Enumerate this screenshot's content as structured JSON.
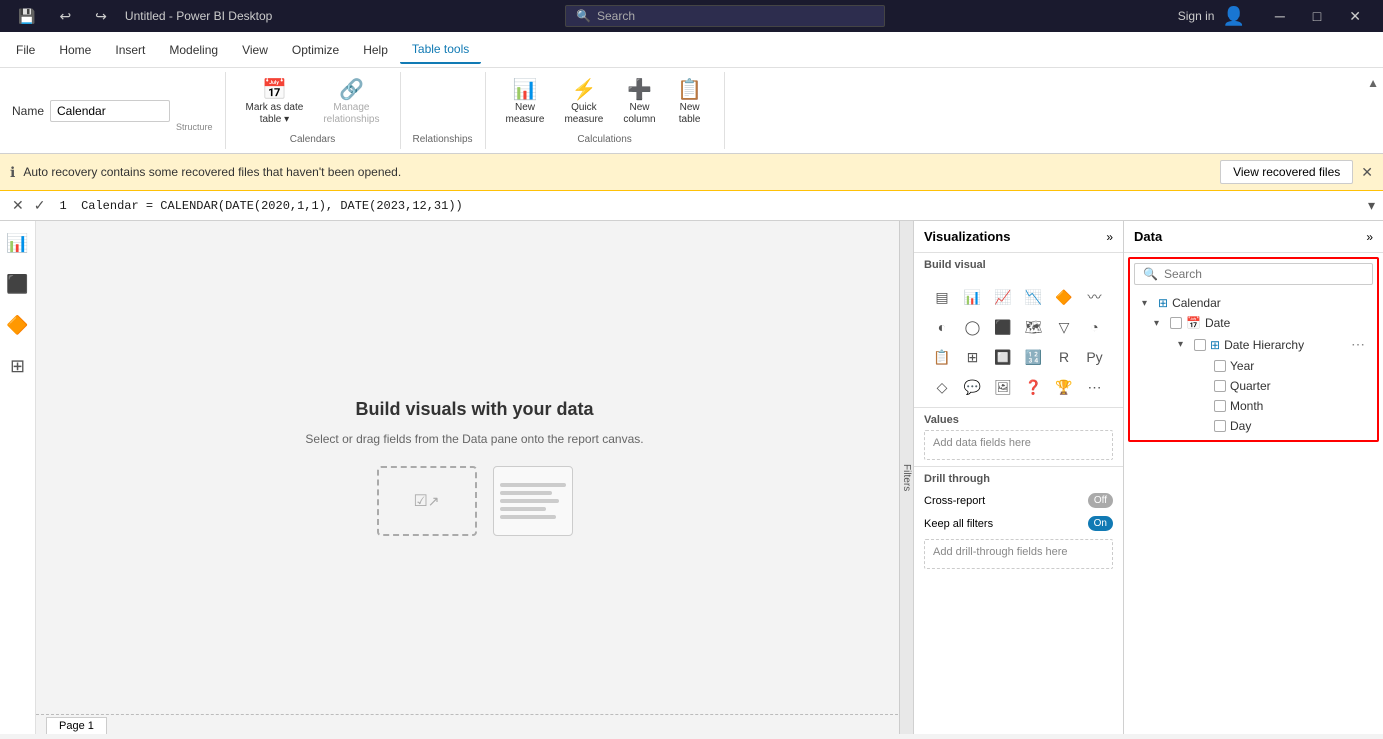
{
  "titleBar": {
    "appName": "Untitled - Power BI Desktop",
    "searchPlaceholder": "Search",
    "signIn": "Sign in"
  },
  "menuBar": {
    "items": [
      "File",
      "Home",
      "Insert",
      "Modeling",
      "View",
      "Optimize",
      "Help",
      "Table tools"
    ]
  },
  "ribbon": {
    "nameLabel": "Name",
    "nameValue": "Calendar",
    "groups": [
      {
        "label": "Structure",
        "buttons": []
      },
      {
        "label": "Calendars",
        "buttons": [
          {
            "icon": "📅",
            "label": "Mark as date\ntable ▾",
            "disabled": false
          },
          {
            "icon": "🔗",
            "label": "Manage\nrelationships",
            "disabled": true
          }
        ]
      },
      {
        "label": "Relationships",
        "buttons": []
      },
      {
        "label": "Calculations",
        "buttons": [
          {
            "icon": "📊",
            "label": "New\nmeasure",
            "disabled": false
          },
          {
            "icon": "⚡",
            "label": "Quick\nmeasure",
            "disabled": false
          },
          {
            "icon": "➕",
            "label": "New\ncolumn",
            "disabled": false
          },
          {
            "icon": "📋",
            "label": "New\ntable",
            "disabled": false
          }
        ]
      }
    ]
  },
  "notification": {
    "message": "Auto recovery contains some recovered files that haven't been opened.",
    "buttonLabel": "View recovered files"
  },
  "formulaBar": {
    "formula": "1  Calendar = CALENDAR(DATE(2020,1,1), DATE(2023,12,31))"
  },
  "canvas": {
    "title": "Build visuals with your data",
    "subtitle": "Select or drag fields from the Data pane onto the report canvas.",
    "pageTab": "Page 1",
    "filtersLabel": "Filters"
  },
  "visualizations": {
    "title": "Visualizations",
    "buildVisualLabel": "Build visual",
    "icons": [
      "▤",
      "📊",
      "📈",
      "📉",
      "🔶",
      "📋",
      "⊞",
      "◐",
      "◯",
      "🔥",
      "🗺",
      "📐",
      "⬛",
      "📊",
      "🔲",
      "🔁",
      "🔢",
      "R",
      "Py",
      "🔷",
      "💬",
      "📦",
      "🏆",
      "📊",
      "⬛",
      "⭐",
      "🔧",
      "⋯"
    ],
    "valuesLabel": "Values",
    "valuesPlaceholder": "Add data fields here",
    "drillThroughLabel": "Drill through",
    "crossReport": "Cross-report",
    "crossReportToggle": "Off",
    "keepAllFilters": "Keep all filters",
    "keepAllFiltersToggle": "On",
    "drillPlaceholder": "Add drill-through fields here"
  },
  "dataPanel": {
    "title": "Data",
    "searchPlaceholder": "Search",
    "tree": {
      "calendar": {
        "label": "Calendar",
        "date": {
          "label": "Date",
          "hierarchy": {
            "label": "Date Hierarchy",
            "items": [
              "Year",
              "Quarter",
              "Month",
              "Day"
            ]
          }
        }
      }
    }
  }
}
